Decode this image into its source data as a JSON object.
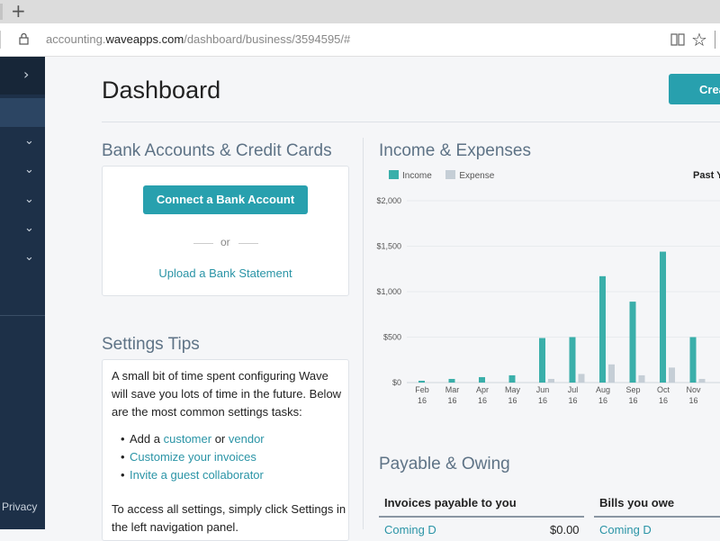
{
  "browser": {
    "url_prefix": "accounting.",
    "url_domain": "waveapps.com",
    "url_path": "/dashboard/business/3594595/#"
  },
  "sidebar": {
    "expand_icon": "›",
    "privacy": "Privacy"
  },
  "header": {
    "title": "Dashboard",
    "create_label": "Crea"
  },
  "bank": {
    "title": "Bank Accounts & Credit Cards",
    "connect_label": "Connect a Bank Account",
    "or_text": "or",
    "upload_label": "Upload a Bank Statement"
  },
  "tips": {
    "title": "Settings Tips",
    "intro": "A small bit of time spent configuring Wave will save you lots of time in the future. Below are the most common settings tasks:",
    "add_prefix": "Add a",
    "customer": "customer",
    "or_word": "or",
    "vendor": "vendor",
    "customize": "Customize your invoices",
    "invite": "Invite a guest collaborator",
    "footer": "To access all settings, simply click Settings in the left navigation panel."
  },
  "income": {
    "title": "Income & Expenses",
    "legend_income": "Income",
    "legend_expense": "Expense",
    "period": "Past Y",
    "colors": {
      "income": "#3aafaa",
      "expense": "#c5ced6"
    }
  },
  "chart_data": {
    "type": "bar",
    "categories": [
      "Feb 16",
      "Mar 16",
      "Apr 16",
      "May 16",
      "Jun 16",
      "Jul 16",
      "Aug 16",
      "Sep 16",
      "Oct 16",
      "Nov 16"
    ],
    "tick_labels": [
      [
        "Feb",
        "16"
      ],
      [
        "Mar",
        "16"
      ],
      [
        "Apr",
        "16"
      ],
      [
        "May",
        "16"
      ],
      [
        "Jun",
        "16"
      ],
      [
        "Jul",
        "16"
      ],
      [
        "Aug",
        "16"
      ],
      [
        "Sep",
        "16"
      ],
      [
        "Oct",
        "16"
      ],
      [
        "Nov",
        "16"
      ]
    ],
    "series": [
      {
        "name": "Income",
        "values": [
          20,
          40,
          60,
          80,
          490,
          500,
          1170,
          890,
          1440,
          500
        ]
      },
      {
        "name": "Expense",
        "values": [
          0,
          0,
          0,
          0,
          40,
          95,
          200,
          80,
          165,
          40
        ]
      }
    ],
    "y_ticks": [
      "$0",
      "$500",
      "$1,000",
      "$1,500",
      "$2,000"
    ],
    "y_values": [
      0,
      500,
      1000,
      1500,
      2000
    ],
    "ylim": [
      0,
      2000
    ],
    "grid": true,
    "legend_position": "top-left",
    "partial_next_tick": "D"
  },
  "payable": {
    "title": "Payable & Owing",
    "invoices_header": "Invoices payable to you",
    "bills_header": "Bills you owe",
    "invoices_row": "Coming D",
    "invoices_amount": "$0.00",
    "bills_row": "Coming D"
  }
}
